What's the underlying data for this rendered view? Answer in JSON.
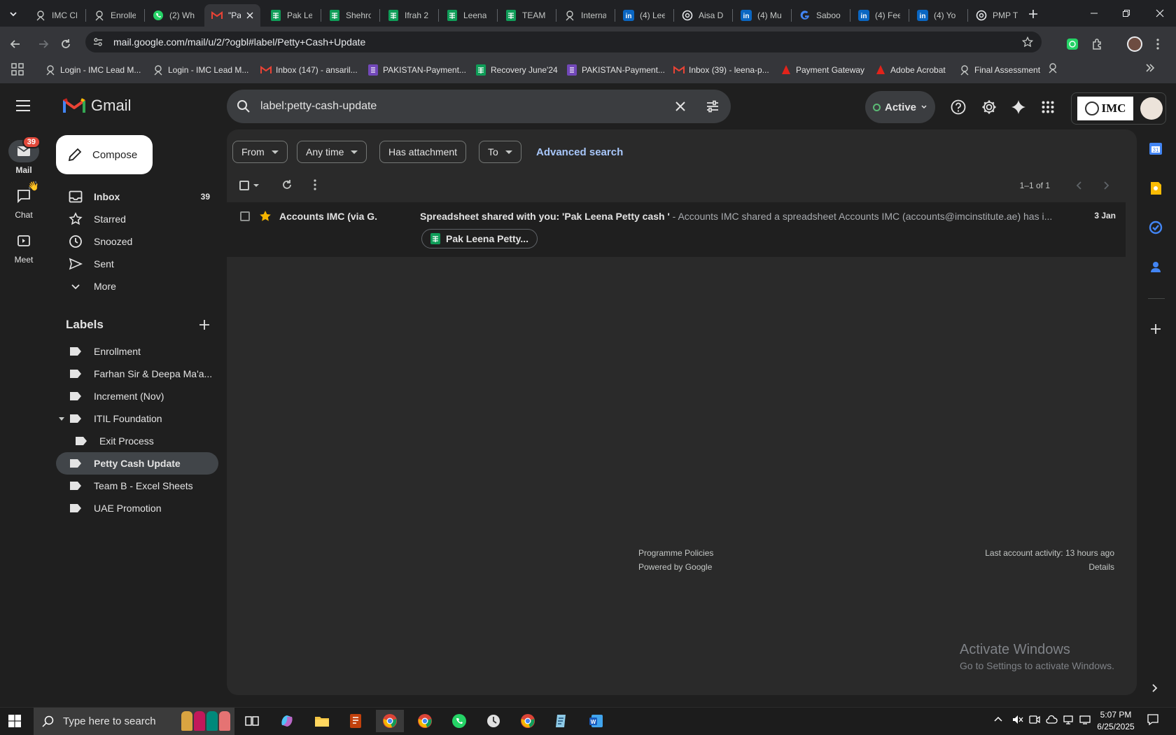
{
  "browser": {
    "tabs": [
      {
        "label": "IMC CF",
        "icon": "imc-icon",
        "color": "#c4c7c5"
      },
      {
        "label": "Enrolle",
        "icon": "imc-icon",
        "color": "#c4c7c5"
      },
      {
        "label": "(2) Wh",
        "icon": "whatsapp-icon",
        "color": "#25d366"
      },
      {
        "label": "\"Pa",
        "icon": "gmail-icon",
        "color": "#ea4335",
        "active": true
      },
      {
        "label": "Pak Le",
        "icon": "sheets-icon",
        "color": "#0f9d58"
      },
      {
        "label": "Shehro",
        "icon": "sheets-icon",
        "color": "#0f9d58"
      },
      {
        "label": "Ifrah 2",
        "icon": "sheets-icon",
        "color": "#0f9d58"
      },
      {
        "label": "Leena",
        "icon": "sheets-icon",
        "color": "#0f9d58"
      },
      {
        "label": "TEAM",
        "icon": "sheets-icon",
        "color": "#0f9d58"
      },
      {
        "label": "Interna",
        "icon": "imc-icon",
        "color": "#c4c7c5"
      },
      {
        "label": "(4) Lee",
        "icon": "linkedin-icon",
        "color": "#0a66c2"
      },
      {
        "label": "Aisa D",
        "icon": "chatgpt-icon",
        "color": "#e8eaed"
      },
      {
        "label": "(4) Mu",
        "icon": "linkedin-icon",
        "color": "#0a66c2"
      },
      {
        "label": "Saboo",
        "icon": "google-icon",
        "color": "#4285f4"
      },
      {
        "label": "(4) Fee",
        "icon": "linkedin-icon",
        "color": "#0a66c2"
      },
      {
        "label": "(4) Yo",
        "icon": "linkedin-icon",
        "color": "#0a66c2"
      },
      {
        "label": "PMP T",
        "icon": "chatgpt-icon",
        "color": "#e8eaed"
      }
    ],
    "url": "mail.google.com/mail/u/2/?ogbl#label/Petty+Cash+Update",
    "bookmarks": [
      {
        "label": "Login - IMC Lead M...",
        "icon": "imc-icon"
      },
      {
        "label": "Login - IMC Lead M...",
        "icon": "imc-icon"
      },
      {
        "label": "Inbox (147) - ansaril...",
        "icon": "gmail-icon"
      },
      {
        "label": "PAKISTAN-Payment...",
        "icon": "forms-icon"
      },
      {
        "label": "Recovery June'24",
        "icon": "sheets-icon"
      },
      {
        "label": "PAKISTAN-Payment...",
        "icon": "forms-icon"
      },
      {
        "label": "Inbox (39) - leena-p...",
        "icon": "gmail-icon"
      },
      {
        "label": "Payment Gateway",
        "icon": "acrobat-icon"
      },
      {
        "label": "Adobe Acrobat",
        "icon": "acrobat-icon"
      },
      {
        "label": "Final Assessment",
        "icon": "imc-icon"
      }
    ]
  },
  "gmail": {
    "logo_text": "Gmail",
    "search_query": "label:petty-cash-update",
    "status": "Active",
    "org_logo": "IMC",
    "rail": {
      "mail": "Mail",
      "mail_badge": "39",
      "chat": "Chat",
      "meet": "Meet"
    },
    "compose": "Compose",
    "nav": [
      {
        "label": "Inbox",
        "count": "39",
        "icon": "inbox-icon"
      },
      {
        "label": "Starred",
        "count": "",
        "icon": "star-icon"
      },
      {
        "label": "Snoozed",
        "count": "",
        "icon": "clock-icon"
      },
      {
        "label": "Sent",
        "count": "",
        "icon": "send-icon"
      },
      {
        "label": "More",
        "count": "",
        "icon": "chevron-down-icon"
      }
    ],
    "labels_heading": "Labels",
    "labels": [
      {
        "label": "Enrollment"
      },
      {
        "label": "Farhan Sir & Deepa Ma'a..."
      },
      {
        "label": "Increment (Nov)"
      },
      {
        "label": "ITIL Foundation"
      },
      {
        "label": "Exit Process"
      },
      {
        "label": "Petty Cash Update"
      },
      {
        "label": "Team B - Excel Sheets"
      },
      {
        "label": "UAE Promotion"
      }
    ],
    "filters": {
      "from": "From",
      "any_time": "Any time",
      "has_attachment": "Has attachment",
      "to": "To",
      "advanced": "Advanced search"
    },
    "pagination": "1–1 of 1",
    "messages": [
      {
        "sender": "Accounts IMC (via G.",
        "subject": "Spreadsheet shared with you: 'Pak Leena Petty cash '",
        "snippet": " - Accounts IMC shared a spreadsheet Accounts IMC (accounts@imcinstitute.ae) has i...",
        "date": "3 Jan",
        "attachment": "Pak Leena Petty..."
      }
    ],
    "footer": {
      "policies": "Programme Policies",
      "powered": "Powered by Google",
      "activity": "Last account activity: 13 hours ago",
      "details": "Details"
    },
    "watermark": {
      "line1": "Activate Windows",
      "line2": "Go to Settings to activate Windows."
    }
  },
  "taskbar": {
    "search_placeholder": "Type here to search",
    "time": "5:07 PM",
    "date": "6/25/2025"
  },
  "colors": {
    "accent_blue": "#a8c7fa",
    "star": "#f4b400",
    "sheets_green": "#0f9d58",
    "badge_red": "#e2493b"
  }
}
